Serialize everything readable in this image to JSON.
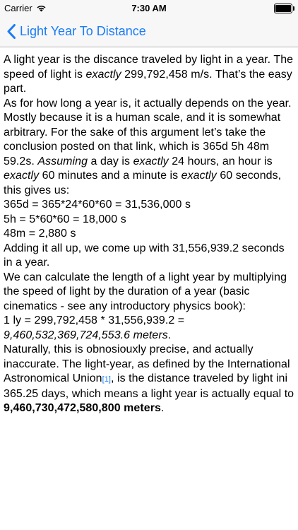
{
  "status_bar": {
    "carrier": "Carrier",
    "time": "7:30 AM"
  },
  "nav": {
    "back_label": "Light Year To Distance"
  },
  "article": {
    "p1_a": "A light year is the discance traveled by light in a year. The speed of light is ",
    "p1_em": "exactly",
    "p1_b": " 299,792,458 m/s. That’s the easy part.",
    "p2_a": "As for how long a year is, it actually depends on the year. Mostly because it is a human scale, and it is somewhat arbitrary. For the sake of this argument let’s take the conclusion posted on that link, which is 365d 5h 48m 59.2s. ",
    "p2_em1": "Assuming",
    "p2_b": " a day is ",
    "p2_em2": "exactly",
    "p2_c": " 24 hours, an hour is ",
    "p2_em3": "exactly",
    "p2_d": " 60 minutes and a minute is ",
    "p2_em4": "exactly",
    "p2_e": " 60 seconds, this gives us:",
    "calc1": "365d = 365*24*60*60 = 31,536,000 s",
    "calc2": "5h = 5*60*60 = 18,000 s",
    "calc3": "48m = 2,880 s",
    "p3": "Adding it all up, we come up with 31,556,939.2 seconds in a year.",
    "p4": "We can calculate the length of a light year by multiplying the speed of light by the duration of a year (basic cinematics - see any introductory physics book):",
    "ly_calc": "1 ly = 299,792,458 * 31,556,939.2 =",
    "ly_result": "9,460,532,369,724,553.6 meters",
    "ly_result_end": ".",
    "p5_a": "Naturally, this is obnosiouxly precise, and actually inaccurate. The light-year, as defined by the International Astronomical Union",
    "p5_ref": "[1]",
    "p5_b": ", is the distance traveled by light ini 365.25 days, which means a light year is actually equal to ",
    "p5_bold": "9,460,730,472,580,800 meters",
    "p5_end": "."
  }
}
